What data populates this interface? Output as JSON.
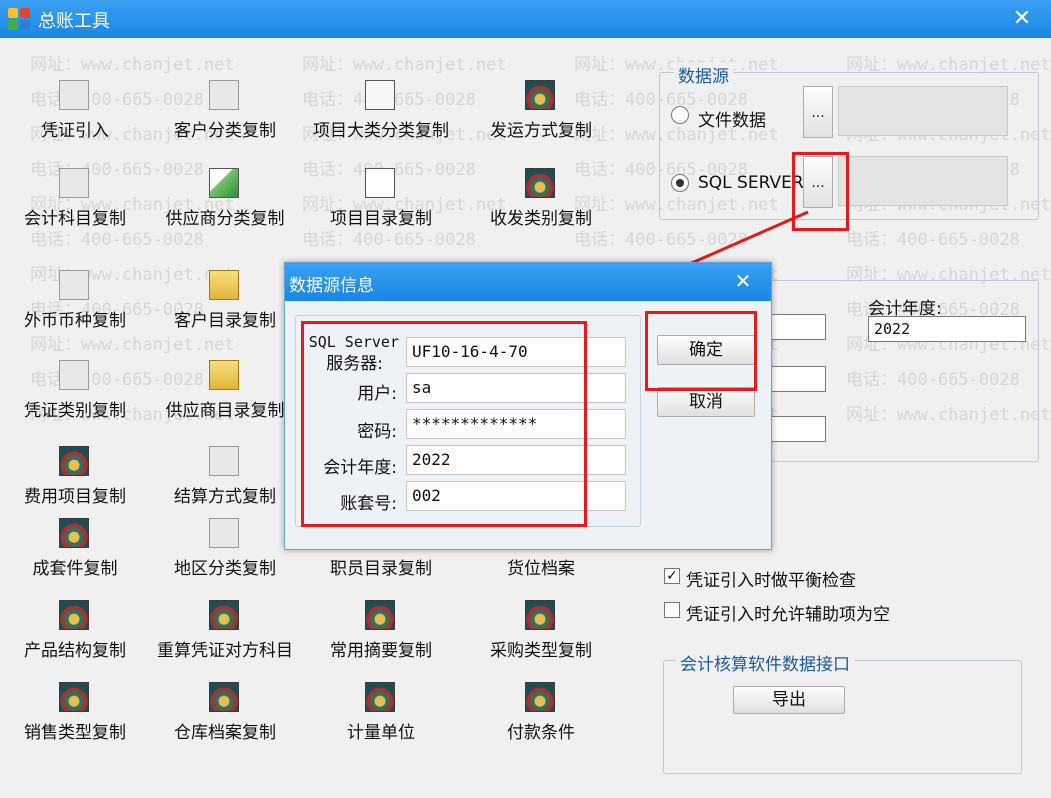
{
  "window": {
    "title": "总账工具",
    "close_glyph": "✕"
  },
  "watermark": {
    "phone": "电话：400-665-0028",
    "site": "网址：www.chanjet.net"
  },
  "tools": [
    {
      "label": "凭证引入",
      "icon": "blank-icon"
    },
    {
      "label": "客户分类复制",
      "icon": "blank-icon"
    },
    {
      "label": "项目大类分类复制",
      "icon": "document-icon"
    },
    {
      "label": "发运方式复制",
      "icon": "film-reel-icon"
    },
    {
      "label": "会计科目复制",
      "icon": "blank-icon"
    },
    {
      "label": "供应商分类复制",
      "icon": "chart-icon"
    },
    {
      "label": "项目目录复制",
      "icon": "menu-icon"
    },
    {
      "label": "收发类别复制",
      "icon": "film-reel-icon"
    },
    {
      "label": "外币币种复制",
      "icon": "blank-icon"
    },
    {
      "label": "客户目录复制",
      "icon": "folder-icon"
    },
    {
      "label": "凭证类别复制",
      "icon": "blank-icon"
    },
    {
      "label": "供应商目录复制",
      "icon": "folder-icon"
    },
    {
      "label": "费用项目复制",
      "icon": "film-reel-icon"
    },
    {
      "label": "结算方式复制",
      "icon": "blank-icon"
    },
    {
      "label": "成套件复制",
      "icon": "film-reel-icon"
    },
    {
      "label": "地区分类复制",
      "icon": "blank-icon"
    },
    {
      "label": "职员目录复制",
      "icon": "none"
    },
    {
      "label": "货位档案",
      "icon": "none"
    },
    {
      "label": "产品结构复制",
      "icon": "film-reel-icon"
    },
    {
      "label": "重算凭证对方科目",
      "icon": "film-reel-icon"
    },
    {
      "label": "常用摘要复制",
      "icon": "film-reel-icon"
    },
    {
      "label": "采购类型复制",
      "icon": "film-reel-icon"
    },
    {
      "label": "销售类型复制",
      "icon": "film-reel-icon"
    },
    {
      "label": "仓库档案复制",
      "icon": "film-reel-icon"
    },
    {
      "label": "计量单位",
      "icon": "film-reel-icon"
    },
    {
      "label": "付款条件",
      "icon": "film-reel-icon"
    }
  ],
  "data_source": {
    "legend": "数据源",
    "option_file": "文件数据",
    "option_sql": "SQL SERVER",
    "selected": "SQL SERVER",
    "browse_label": "..."
  },
  "fiscal_year": {
    "label": "会计年度:",
    "value": "2022"
  },
  "options": {
    "balance_check_label": "凭证引入时做平衡检查",
    "balance_check_checked": true,
    "allow_empty_aux_label": "凭证引入时允许辅助项为空",
    "allow_empty_aux_checked": false
  },
  "interface": {
    "legend": "会计核算软件数据接口",
    "export_label": "导出"
  },
  "dialog": {
    "title": "数据源信息",
    "close_glyph": "✕",
    "server_label_line1": "SQL Server",
    "server_label_line2": "服务器:",
    "server_value": "UF10-16-4-70",
    "user_label": "用户:",
    "user_value": "sa",
    "password_label": "密码:",
    "password_value": "*************",
    "year_label": "会计年度:",
    "year_value": "2022",
    "account_label": "账套号:",
    "account_value": "002",
    "ok_label": "确定",
    "cancel_label": "取消"
  },
  "colors": {
    "titlebar": "#1a86e4",
    "highlight": "#e21b1b",
    "legend_text": "#1a5aa6"
  }
}
